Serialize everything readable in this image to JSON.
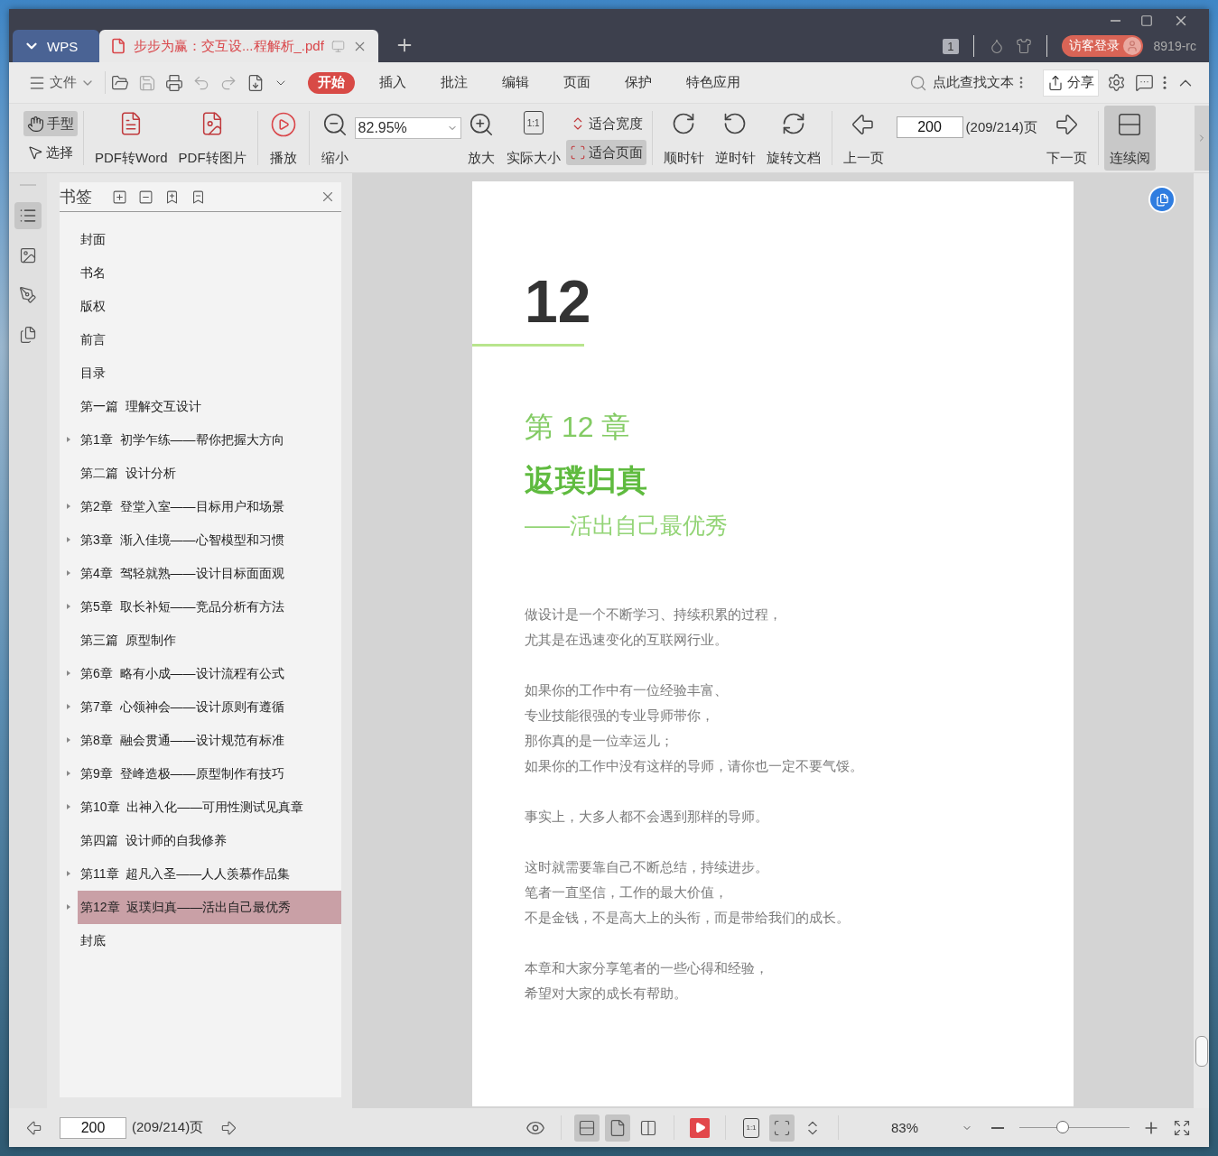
{
  "window": {
    "tabs": [
      {
        "kind": "home",
        "label": "WPS",
        "selected": false
      },
      {
        "kind": "document",
        "label": "步步为赢：交互设...程解析_.pdf",
        "selected": true
      }
    ],
    "page_badge": "1",
    "login_button": "访客登录",
    "user_name": "8919-rc"
  },
  "menu_bar": {
    "file_menu": "文件",
    "tabs": [
      {
        "label": "开始",
        "selected": true
      },
      {
        "label": "插入",
        "selected": false
      },
      {
        "label": "批注",
        "selected": false
      },
      {
        "label": "编辑",
        "selected": false
      },
      {
        "label": "页面",
        "selected": false
      },
      {
        "label": "保护",
        "selected": false
      },
      {
        "label": "特色应用",
        "selected": false
      }
    ],
    "search_placeholder": "点此查找文本",
    "share_button": "分享"
  },
  "toolbar": {
    "mode_tools": [
      {
        "label": "手型",
        "selected": true
      },
      {
        "label": "选择",
        "selected": false
      }
    ],
    "convert_tools": [
      {
        "kind": "word",
        "label": "PDF转Word"
      },
      {
        "kind": "image",
        "label": "PDF转图片"
      }
    ],
    "play": "播放",
    "zoom_out": "缩小",
    "zoom_value": "82.95%",
    "zoom_in": "放大",
    "actual_size": "实际大小",
    "actual_size_icon": "1:1",
    "fit_tools": [
      {
        "kind": "width",
        "label": "适合宽度",
        "selected": false
      },
      {
        "kind": "page",
        "label": "适合页面",
        "selected": true
      }
    ],
    "rotate_tools": [
      {
        "kind": "cw",
        "label": "顺时针"
      },
      {
        "kind": "ccw",
        "label": "逆时针"
      },
      {
        "kind": "doc",
        "label": "旋转文档"
      }
    ],
    "prev_page": "上一页",
    "page_input": "200",
    "page_count": "(209/214)页",
    "next_page": "下一页",
    "continuous_read": {
      "label": "连续阅",
      "selected": true
    }
  },
  "bookmarks": {
    "title": "书签",
    "items": [
      {
        "label": "封面",
        "expandable": false,
        "selected": false
      },
      {
        "label": "书名",
        "expandable": false,
        "selected": false
      },
      {
        "label": "版权",
        "expandable": false,
        "selected": false
      },
      {
        "label": "前言",
        "expandable": false,
        "selected": false
      },
      {
        "label": "目录",
        "expandable": false,
        "selected": false
      },
      {
        "label": "第一篇  理解交互设计",
        "expandable": false,
        "selected": false
      },
      {
        "label": "第1章  初学乍练——帮你把握大方向",
        "expandable": true,
        "selected": false
      },
      {
        "label": "第二篇  设计分析",
        "expandable": false,
        "selected": false
      },
      {
        "label": "第2章  登堂入室——目标用户和场景",
        "expandable": true,
        "selected": false
      },
      {
        "label": "第3章  渐入佳境——心智模型和习惯",
        "expandable": true,
        "selected": false
      },
      {
        "label": "第4章  驾轻就熟——设计目标面面观",
        "expandable": true,
        "selected": false
      },
      {
        "label": "第5章  取长补短——竞品分析有方法",
        "expandable": true,
        "selected": false
      },
      {
        "label": "第三篇  原型制作",
        "expandable": false,
        "selected": false
      },
      {
        "label": "第6章  略有小成——设计流程有公式",
        "expandable": true,
        "selected": false
      },
      {
        "label": "第7章  心领神会——设计原则有遵循",
        "expandable": true,
        "selected": false
      },
      {
        "label": "第8章  融会贯通——设计规范有标准",
        "expandable": true,
        "selected": false
      },
      {
        "label": "第9章  登峰造极——原型制作有技巧",
        "expandable": true,
        "selected": false
      },
      {
        "label": "第10章  出神入化——可用性测试见真章",
        "expandable": true,
        "selected": false
      },
      {
        "label": "第四篇  设计师的自我修养",
        "expandable": false,
        "selected": false
      },
      {
        "label": "第11章  超凡入圣——人人羡慕作品集",
        "expandable": true,
        "selected": false
      },
      {
        "label": "第12章  返璞归真——活出自己最优秀",
        "expandable": true,
        "selected": true
      },
      {
        "label": "封底",
        "expandable": false,
        "selected": false
      }
    ]
  },
  "document_page": {
    "chapter_number": "12",
    "chapter_label": "第 12 章",
    "title": "返璞归真",
    "subtitle": "——活出自己最优秀",
    "paragraphs": [
      [
        "做设计是一个不断学习、持续积累的过程，",
        "尤其是在迅速变化的互联网行业。"
      ],
      [
        "如果你的工作中有一位经验丰富、",
        "专业技能很强的专业导师带你，",
        "那你真的是一位幸运儿；",
        "如果你的工作中没有这样的导师，请你也一定不要气馁。"
      ],
      [
        "事实上，大多人都不会遇到那样的导师。"
      ],
      [
        "这时就需要靠自己不断总结，持续进步。",
        "笔者一直坚信，工作的最大价值，",
        "不是金钱，不是高大上的头衔，而是带给我们的成长。"
      ],
      [
        "本章和大家分享笔者的一些心得和经验，",
        "希望对大家的成长有帮助。"
      ]
    ]
  },
  "status_bar": {
    "page_input": "200",
    "page_count": "(209/214)页",
    "view_modes": [
      {
        "kind": "continuous",
        "selected": true
      },
      {
        "kind": "single",
        "selected": true
      },
      {
        "kind": "double",
        "selected": false
      }
    ],
    "fit_modes": [
      {
        "kind": "actual",
        "icon": "1:1",
        "selected": false
      },
      {
        "kind": "page",
        "selected": true
      },
      {
        "kind": "width",
        "selected": false
      }
    ],
    "zoom": "83%",
    "zoom_slider": {
      "level": 0.39
    }
  }
}
